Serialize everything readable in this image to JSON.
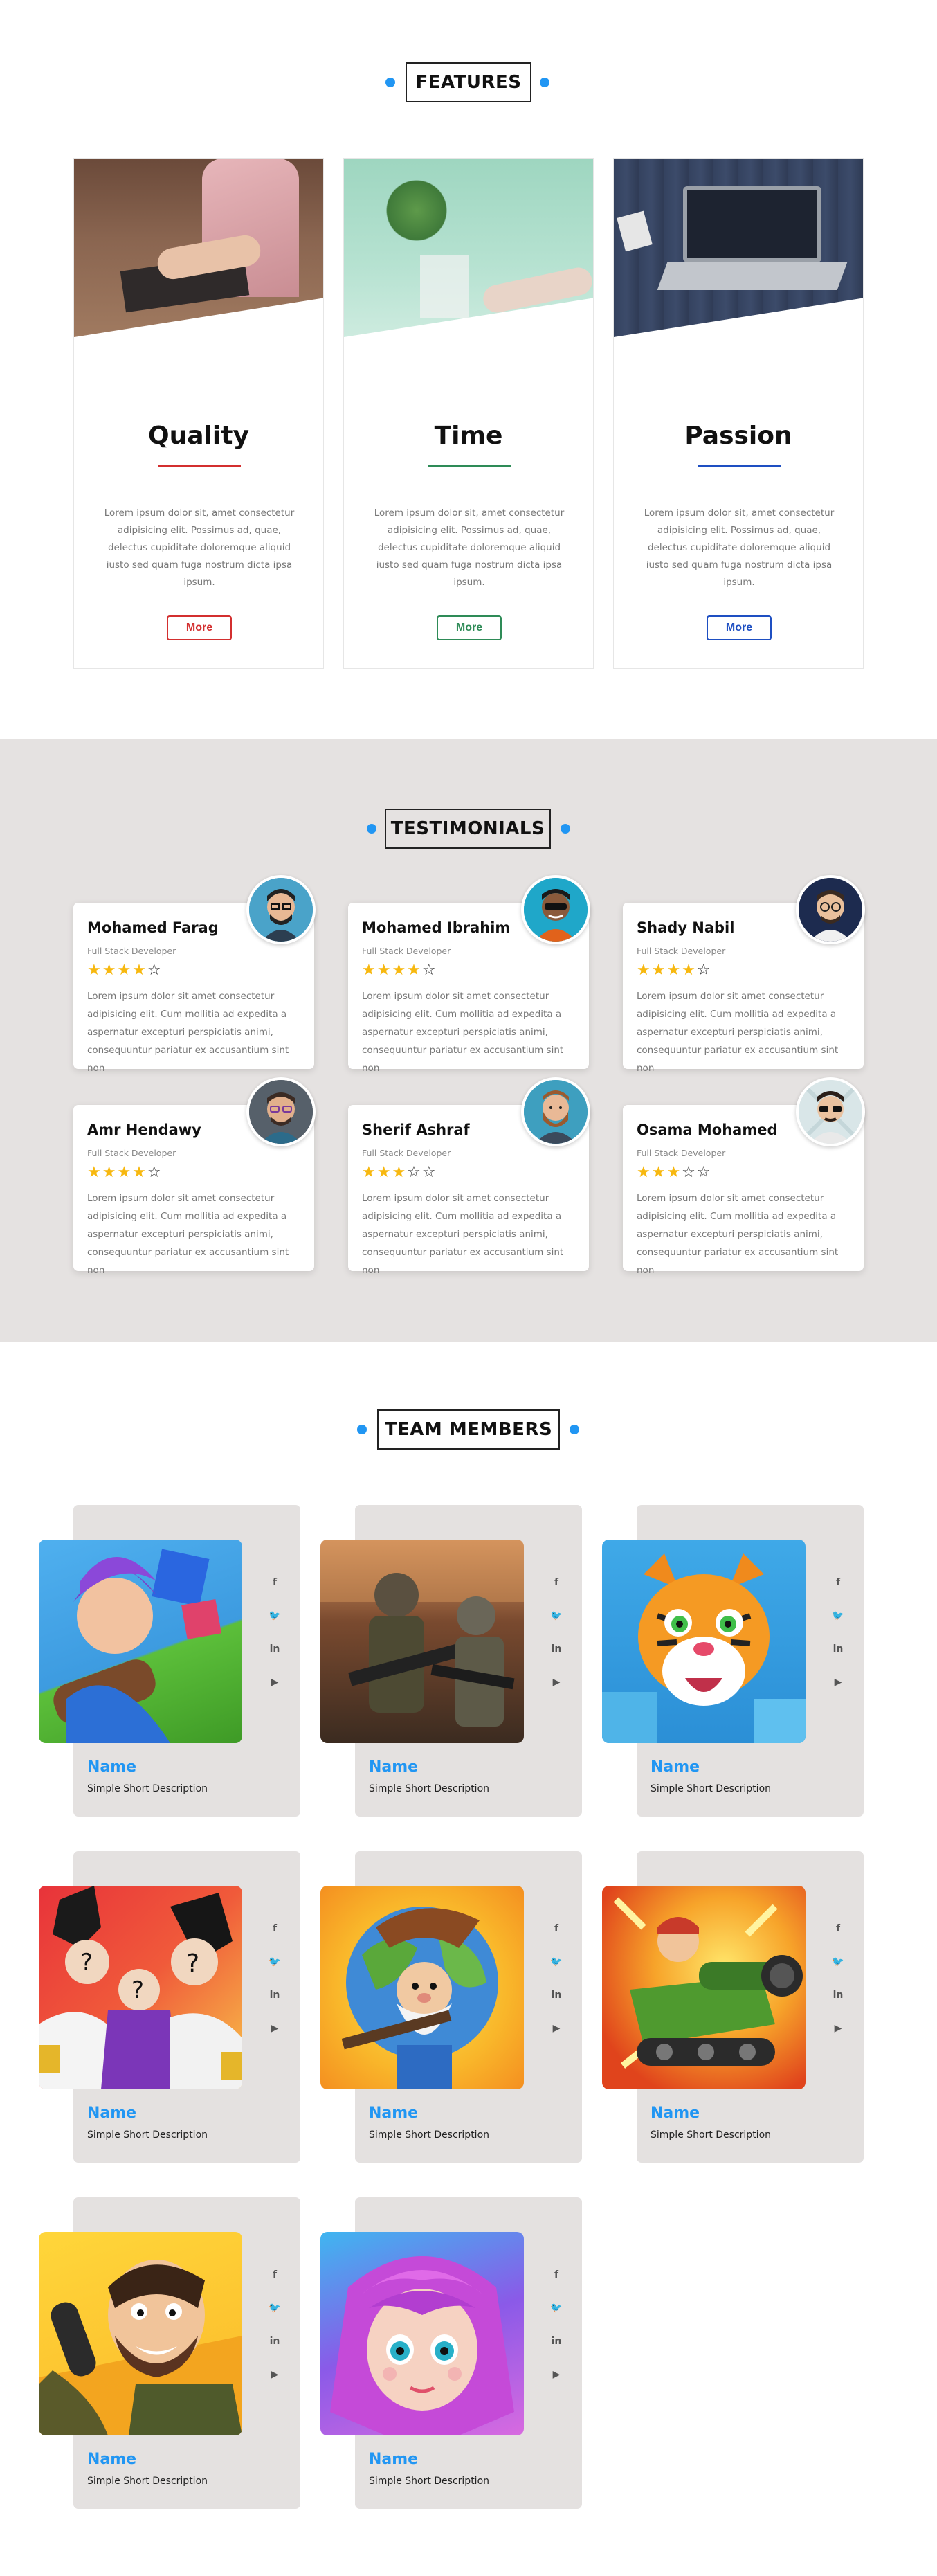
{
  "features": {
    "heading": "FEATURES",
    "cards": [
      {
        "title": "Quality",
        "text": "Lorem ipsum dolor sit, amet consectetur adipisicing elit. Possimus ad, quae, delectus cupiditate doloremque aliquid iusto sed quam fuga nostrum dicta ipsa ipsum.",
        "button": "More",
        "accent": "#d32f2f"
      },
      {
        "title": "Time",
        "text": "Lorem ipsum dolor sit, amet consectetur adipisicing elit. Possimus ad, quae, delectus cupiditate doloremque aliquid iusto sed quam fuga nostrum dicta ipsa ipsum.",
        "button": "More",
        "accent": "#2e8b57"
      },
      {
        "title": "Passion",
        "text": "Lorem ipsum dolor sit, amet consectetur adipisicing elit. Possimus ad, quae, delectus cupiditate doloremque aliquid iusto sed quam fuga nostrum dicta ipsa ipsum.",
        "button": "More",
        "accent": "#1e4fc2"
      }
    ]
  },
  "testimonials": {
    "heading": "TESTIMONIALS",
    "items": [
      {
        "name": "Mohamed Farag",
        "role": "Full Stack Developer",
        "rating": 4,
        "stars": "★★★★",
        "empty": "☆",
        "text": "Lorem ipsum dolor sit amet consectetur adipisicing elit. Cum mollitia ad expedita a aspernatur excepturi perspiciatis animi, consequuntur pariatur ex accusantium sint non"
      },
      {
        "name": "Mohamed Ibrahim",
        "role": "Full Stack Developer",
        "rating": 4,
        "stars": "★★★★",
        "empty": "☆",
        "text": "Lorem ipsum dolor sit amet consectetur adipisicing elit. Cum mollitia ad expedita a aspernatur excepturi perspiciatis animi, consequuntur pariatur ex accusantium sint non"
      },
      {
        "name": "Shady Nabil",
        "role": "Full Stack Developer",
        "rating": 4,
        "stars": "★★★★",
        "empty": "☆",
        "text": "Lorem ipsum dolor sit amet consectetur adipisicing elit. Cum mollitia ad expedita a aspernatur excepturi perspiciatis animi, consequuntur pariatur ex accusantium sint non"
      },
      {
        "name": "Amr Hendawy",
        "role": "Full Stack Developer",
        "rating": 4,
        "stars": "★★★★",
        "empty": "☆",
        "text": "Lorem ipsum dolor sit amet consectetur adipisicing elit. Cum mollitia ad expedita a aspernatur excepturi perspiciatis animi, consequuntur pariatur ex accusantium sint non"
      },
      {
        "name": "Sherif Ashraf",
        "role": "Full Stack Developer",
        "rating": 3,
        "stars": "★★★",
        "empty": "☆☆",
        "text": "Lorem ipsum dolor sit amet consectetur adipisicing elit. Cum mollitia ad expedita a aspernatur excepturi perspiciatis animi, consequuntur pariatur ex accusantium sint non"
      },
      {
        "name": "Osama Mohamed",
        "role": "Full Stack Developer",
        "rating": 3,
        "stars": "★★★",
        "empty": "☆☆",
        "text": "Lorem ipsum dolor sit amet consectetur adipisicing elit. Cum mollitia ad expedita a aspernatur excepturi perspiciatis animi, consequuntur pariatur ex accusantium sint non"
      }
    ]
  },
  "team": {
    "heading": "TEAM MEMBERS",
    "members": [
      {
        "name": "Name",
        "description": "Simple Short Description"
      },
      {
        "name": "Name",
        "description": "Simple Short Description"
      },
      {
        "name": "Name",
        "description": "Simple Short Description"
      },
      {
        "name": "Name",
        "description": "Simple Short Description"
      },
      {
        "name": "Name",
        "description": "Simple Short Description"
      },
      {
        "name": "Name",
        "description": "Simple Short Description"
      },
      {
        "name": "Name",
        "description": "Simple Short Description"
      },
      {
        "name": "Name",
        "description": "Simple Short Description"
      }
    ],
    "social": {
      "facebook": "f",
      "twitter": "🐦",
      "linkedin": "in",
      "youtube": "▶"
    }
  },
  "colors": {
    "accent_blue": "#2196f3",
    "testimonial_bg": "#e5e2e1",
    "team_panel_bg": "#e4e1e0",
    "star_gold": "#f7b80f"
  }
}
